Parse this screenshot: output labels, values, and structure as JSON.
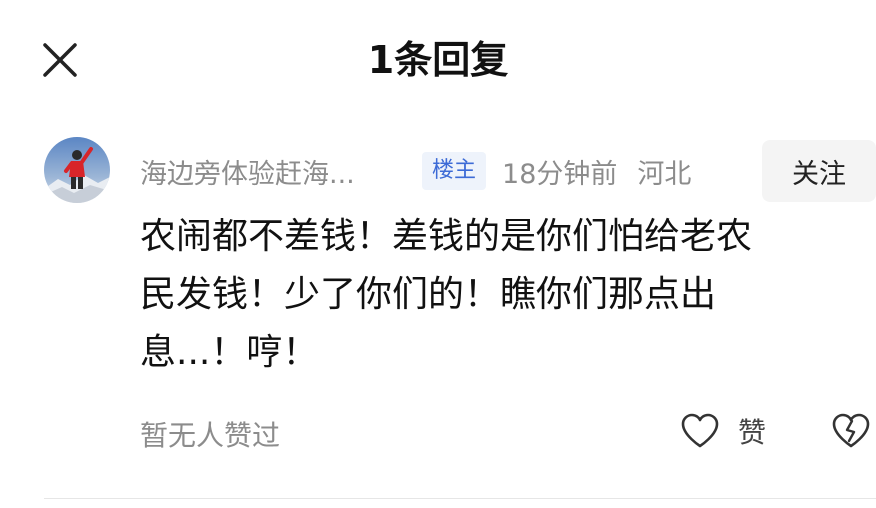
{
  "header": {
    "title": "1条回复"
  },
  "comment": {
    "username": "海边旁体验赶海...",
    "badge": "楼主",
    "time": "18分钟前",
    "location": "河北",
    "follow_label": "关注",
    "text_lines": [
      "农闹都不差钱！差钱的是你们怕给老农",
      "民发钱！少了你们的！瞧你们那点出",
      "息...！哼！"
    ],
    "likes_text": "暂无人赞过",
    "like_label": "赞"
  },
  "icons": {
    "close": "close-icon",
    "like": "heart-icon",
    "dislike": "broken-heart-icon"
  },
  "colors": {
    "badge_text": "#3d6bd6",
    "badge_bg": "#eef3fb",
    "meta_text": "#8c8c8c"
  }
}
